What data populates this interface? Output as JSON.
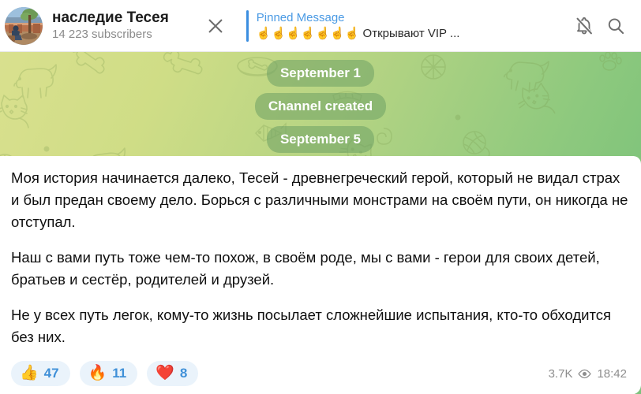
{
  "header": {
    "avatar_name": "channel-avatar",
    "channel_title": "наследие Тесея",
    "subscribers": "14 223 subscribers",
    "close_icon": "close-icon",
    "pinned": {
      "label": "Pinned Message",
      "emojis": "☝☝☝☝☝☝☝",
      "preview_text": "Открывают VIP ...",
      "accent_color": "#3b8ee0"
    },
    "mute_icon": "bell-muted-icon",
    "search_icon": "search-icon"
  },
  "chat": {
    "background_colors": [
      "#d9e08e",
      "#72bf78"
    ],
    "pills": [
      {
        "label": "September 1",
        "name": "date-pill-september-1"
      },
      {
        "label": "Channel created",
        "name": "service-pill-channel-created"
      },
      {
        "label": "September 5",
        "name": "date-pill-september-5"
      }
    ]
  },
  "message": {
    "paragraphs": [
      "Моя история начинается далеко, Тесей - древнегреческий герой, который не видал страх и был предан своему дело. Борься с различными монстрами на своём пути, он никогда не отступал.",
      "Наш с вами путь тоже чем-то похож, в своём роде, мы с вами - герои для своих детей, братьев и сестёр, родителей и друзей.",
      "Не у всех путь легок, кому-то жизнь посылает сложнейшие испытания, кто-то обходится без них."
    ],
    "reactions": [
      {
        "emoji": "👍",
        "name": "reaction-thumbs-up",
        "count": "47"
      },
      {
        "emoji": "🔥",
        "name": "reaction-fire",
        "count": "11"
      },
      {
        "emoji": "❤️",
        "name": "reaction-heart",
        "count": "8"
      }
    ],
    "reaction_count_color": "#3f90d8",
    "views": "3.7K",
    "views_icon": "eye-icon",
    "time": "18:42"
  }
}
